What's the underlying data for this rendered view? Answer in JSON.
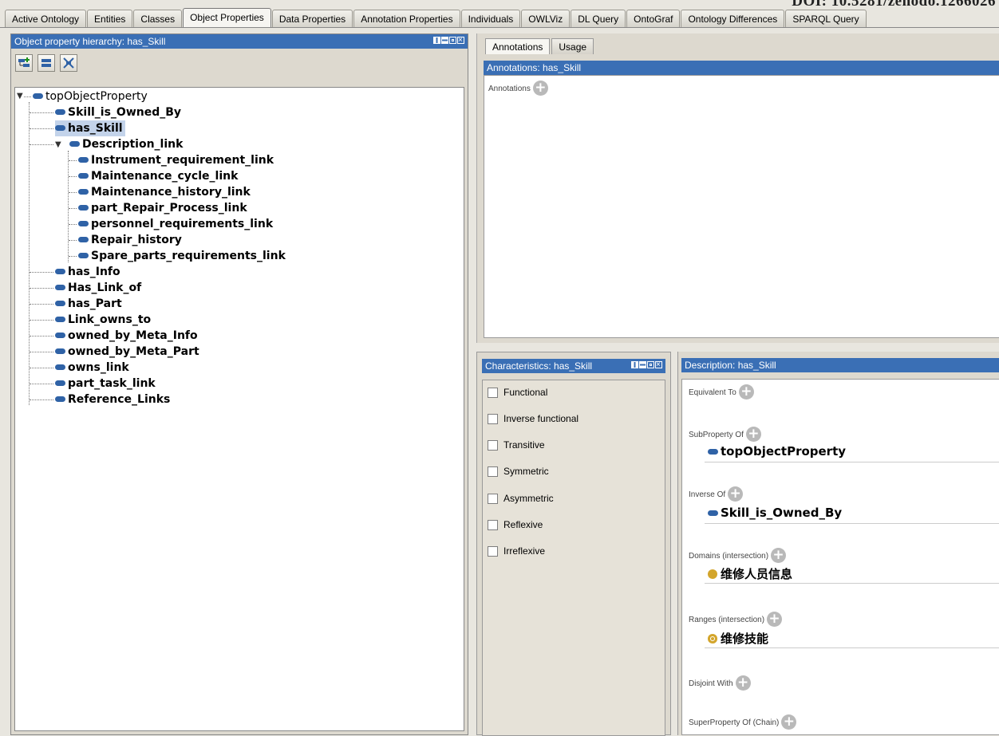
{
  "watermark": "DOI: 10.5281/zenodo.1266026",
  "tabs": [
    "Active Ontology",
    "Entities",
    "Classes",
    "Object Properties",
    "Data Properties",
    "Annotation Properties",
    "Individuals",
    "OWLViz",
    "DL Query",
    "OntoGraf",
    "Ontology Differences",
    "SPARQL Query"
  ],
  "active_tab": "Object Properties",
  "hierarchy": {
    "title": "Object property hierarchy: has_Skill",
    "root": "topObjectProperty",
    "children": [
      "Skill_is_Owned_By",
      "has_Skill",
      "Description_link",
      "has_Info",
      "Has_Link_of",
      "has_Part",
      "Link_owns_to",
      "owned_by_Meta_Info",
      "owned_by_Meta_Part",
      "owns_link",
      "part_task_link",
      "Reference_Links"
    ],
    "description_children": [
      "Instrument_requirement_link",
      "Maintenance_cycle_link",
      "Maintenance_history_link",
      "part_Repair_Process_link",
      "personnel_requirements_link",
      "Repair_history",
      "Spare_parts_requirements_link"
    ],
    "selected": "has_Skill"
  },
  "annotations": {
    "tabs": [
      "Annotations",
      "Usage"
    ],
    "header": "Annotations: has_Skill",
    "label": "Annotations"
  },
  "characteristics": {
    "header": "Characteristics: has_Skill",
    "items": [
      "Functional",
      "Inverse functional",
      "Transitive",
      "Symmetric",
      "Asymmetric",
      "Reflexive",
      "Irreflexive"
    ]
  },
  "description": {
    "header": "Description: has_Skill",
    "equivalent_to": "Equivalent To",
    "subproperty_of": "SubProperty Of",
    "subproperty_value": "topObjectProperty",
    "inverse_of": "Inverse Of",
    "inverse_value": "Skill_is_Owned_By",
    "domains": "Domains (intersection)",
    "domain_value": "维修人员信息",
    "ranges": "Ranges (intersection)",
    "range_value": "维修技能",
    "disjoint_with": "Disjoint With",
    "superproperty_chain": "SuperProperty Of (Chain)"
  },
  "colors": {
    "header_blue": "#3a6fb5",
    "property_chip": "#2f62a6",
    "class_dot": "#d3a52b"
  }
}
